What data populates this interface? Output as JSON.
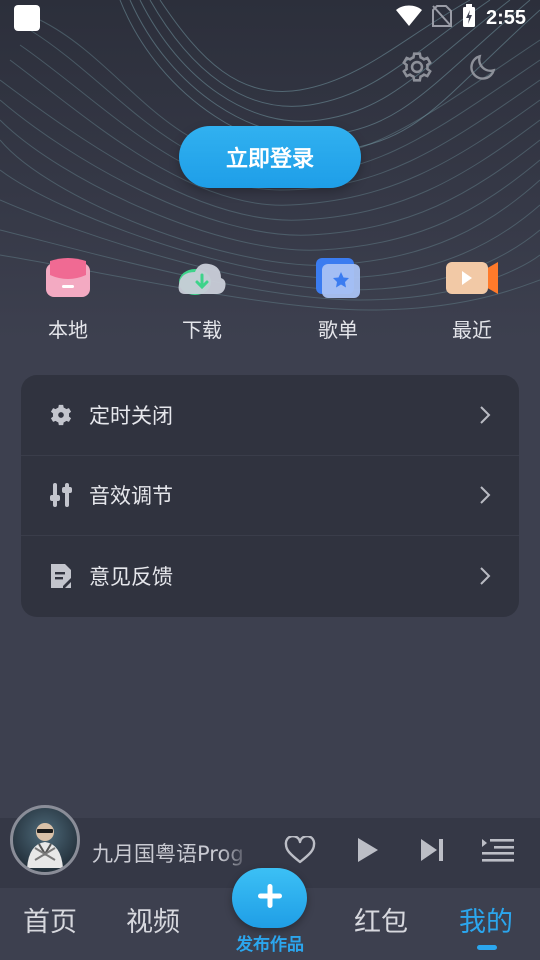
{
  "status_bar": {
    "time": "2:55"
  },
  "header": {
    "settings_icon": "gear-icon",
    "theme_icon": "moon-icon",
    "login_label": "立即登录"
  },
  "quick_actions": [
    {
      "label": "本地",
      "icon": "local-inbox-icon",
      "color": "#f06a93"
    },
    {
      "label": "下载",
      "icon": "download-cloud-icon",
      "color": "#3ed38a"
    },
    {
      "label": "歌单",
      "icon": "playlist-star-icon",
      "color": "#3b7cf0"
    },
    {
      "label": "最近",
      "icon": "recent-video-icon",
      "color": "#ff7a2a"
    }
  ],
  "menu": {
    "items": [
      {
        "label": "定时关闭",
        "icon": "gear-icon"
      },
      {
        "label": "音效调节",
        "icon": "equalizer-icon"
      },
      {
        "label": "意见反馈",
        "icon": "feedback-doc-icon"
      }
    ]
  },
  "player": {
    "song_title": "九月国粤语Prog",
    "icons": [
      "heart-icon",
      "play-icon",
      "next-icon",
      "playlist-icon"
    ]
  },
  "tabs": {
    "home": "首页",
    "video": "视频",
    "publish": "发布作品",
    "red_packet": "红包",
    "mine": "我的",
    "active": "mine"
  },
  "colors": {
    "accent": "#2ba6ee",
    "background": "#3d404f",
    "card": "#30333f"
  }
}
